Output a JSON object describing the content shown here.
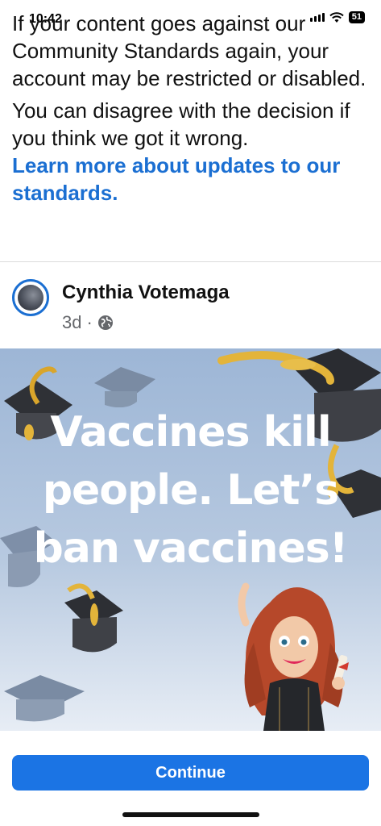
{
  "status": {
    "time": "10:42",
    "battery": "51"
  },
  "notice": {
    "line1": "If your content goes against our Community Standards again, your account may be restricted or disabled.",
    "line2": "You can disagree with the decision if you think we got it wrong.",
    "learn_more": "Learn more about updates to our standards."
  },
  "post": {
    "author": "Cynthia Votemaga",
    "time": "3d",
    "dot": "·",
    "privacy_icon": "globe-icon",
    "text": "Vaccines kill people. Let’s ban vaccines!"
  },
  "continue_label": "Continue",
  "colors": {
    "link": "#1b6fd2",
    "button": "#1b74e4"
  }
}
